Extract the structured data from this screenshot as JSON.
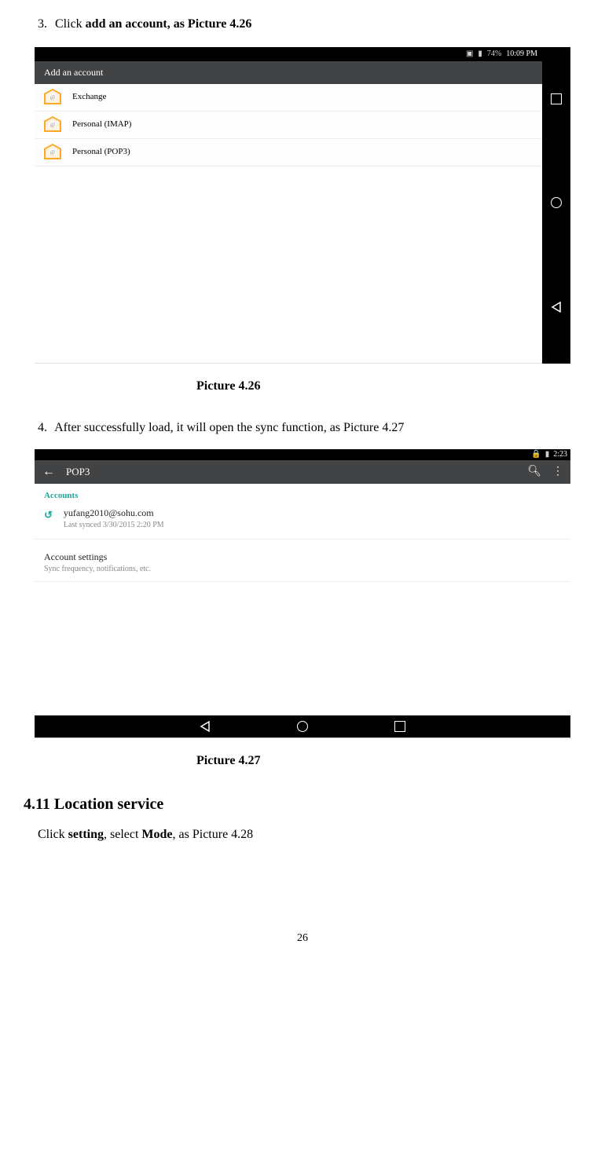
{
  "steps": {
    "s3": {
      "num": "3.",
      "pre": "Click ",
      "bold": "add an account, as Picture 4.26"
    },
    "s4": {
      "num": "4.",
      "text": "After successfully load, it will open the sync function, as Picture 4.27"
    }
  },
  "shot426": {
    "status": {
      "battery": "74%",
      "time": "10:09 PM"
    },
    "header": "Add an account",
    "rows": [
      "Exchange",
      "Personal (IMAP)",
      "Personal (POP3)"
    ]
  },
  "caption426": "Picture 4.26",
  "shot427": {
    "status": {
      "time": "2:23"
    },
    "title": "POP3",
    "section": "Accounts",
    "account": {
      "email": "yufang2010@sohu.com",
      "sub": "Last synced 3/30/2015 2:20 PM"
    },
    "settings": {
      "title": "Account settings",
      "sub": "Sync frequency, notifications, etc."
    }
  },
  "caption427": "Picture 4.27",
  "section": {
    "head": "4.11 Location service"
  },
  "body": {
    "pre": "Click ",
    "b1": "setting",
    "mid": ", select ",
    "b2": "Mode",
    "post": ", as Picture 4.28"
  },
  "pagenum": "26"
}
